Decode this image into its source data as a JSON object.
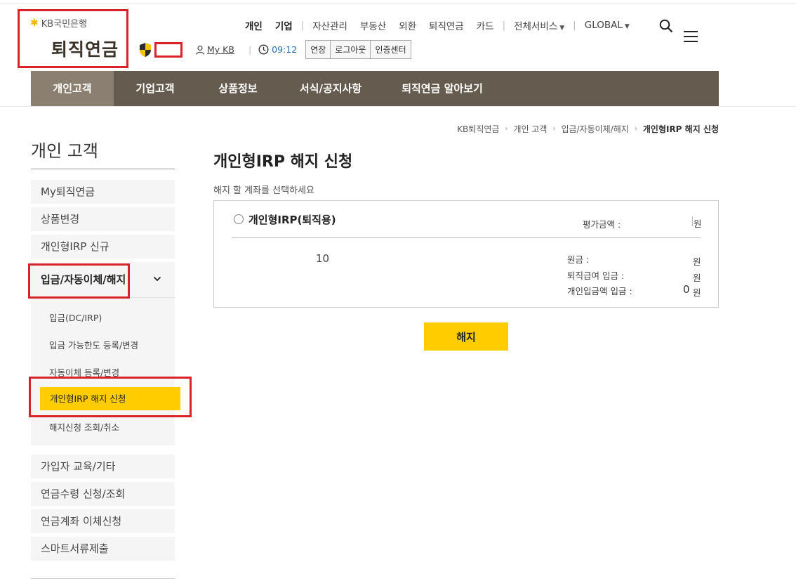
{
  "logo": {
    "bank_name": "KB국민은행",
    "title": "퇴직연금"
  },
  "top_nav": {
    "items": [
      "개인",
      "기업",
      "자산관리",
      "부동산",
      "외환",
      "퇴직연금",
      "카드",
      "전체서비스",
      "GLOBAL"
    ]
  },
  "user_bar": {
    "mykb_label": "My KB",
    "session_time": "09:12",
    "buttons": [
      "연장",
      "로그아웃",
      "인증센터"
    ]
  },
  "gnb": {
    "items": [
      "개인고객",
      "기업고객",
      "상품정보",
      "서식/공지사항",
      "퇴직연금 알아보기"
    ]
  },
  "breadcrumb": [
    "KB퇴직연금",
    "개인 고객",
    "입금/자동이체/해지",
    "개인형IRP 해지 신청"
  ],
  "sidebar": {
    "title": "개인 고객",
    "items_top": [
      "My퇴직연금",
      "상품변경",
      "개인형IRP 신규"
    ],
    "open_section": {
      "label": "입금/자동이체/해지",
      "sub_items": [
        "입금(DC/IRP)",
        "입금 가능한도 등록/변경",
        "자동이체 등록/변경",
        "개인형IRP 해지 신청",
        "해지신청 조회/취소"
      ]
    },
    "items_bottom": [
      "가입자 교육/기타",
      "연금수령 신청/조회",
      "연금계좌 이체신청",
      "스마트서류제출"
    ]
  },
  "main": {
    "title": "개인형IRP 해지 신청",
    "description": "해지 할 계좌를 선택하세요",
    "account": {
      "name": "개인형IRP(퇴직용)",
      "eval_label": "평가금액 :",
      "unit": "원",
      "account_number_fragment": "10",
      "principal_label": "원금 :",
      "retirement_deposit_label": "퇴직급여 입금 :",
      "personal_deposit_label": "개인입금액 입금 :",
      "personal_deposit_value": "0"
    },
    "cancel_button": "해지"
  },
  "colors": {
    "gnb_bg": "#655b4e",
    "accent_yellow": "#ffcc00",
    "highlight_red": "#d8232a"
  }
}
